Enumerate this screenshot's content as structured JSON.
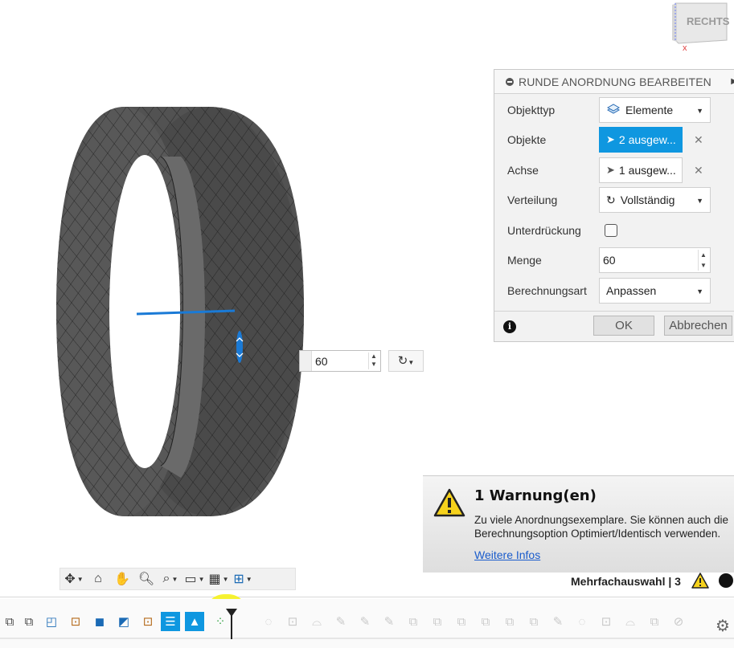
{
  "viewcube": {
    "face_label": "RECHTS",
    "axis_label": "x"
  },
  "inline_input": {
    "value": "60"
  },
  "dialog": {
    "title": "RUNDE ANORDNUNG BEARBEITEN",
    "rows": {
      "objekttyp": {
        "label": "Objekttyp",
        "value": "Elemente"
      },
      "objekte": {
        "label": "Objekte",
        "value": "2 ausgew..."
      },
      "achse": {
        "label": "Achse",
        "value": "1 ausgew..."
      },
      "verteilung": {
        "label": "Verteilung",
        "value": "Vollständig"
      },
      "unterdrueckung": {
        "label": "Unterdrückung",
        "checked": false
      },
      "menge": {
        "label": "Menge",
        "value": "60"
      },
      "berechnungsart": {
        "label": "Berechnungsart",
        "value": "Anpassen"
      }
    },
    "ok_label": "OK",
    "cancel_label": "Abbrechen"
  },
  "warning": {
    "title": "1 Warnung(en)",
    "message": "Zu viele Anordnungsexemplare. Sie können auch die Berechnungsoption Optimiert/Identisch verwenden.",
    "link": "Weitere Infos"
  },
  "status": {
    "selection": "Mehrfachauswahl | 3"
  },
  "colors": {
    "accent": "#0f97e0",
    "warning": "#f6d21c",
    "highlight": "#f6f21c",
    "axis": "#1a7ad6"
  }
}
